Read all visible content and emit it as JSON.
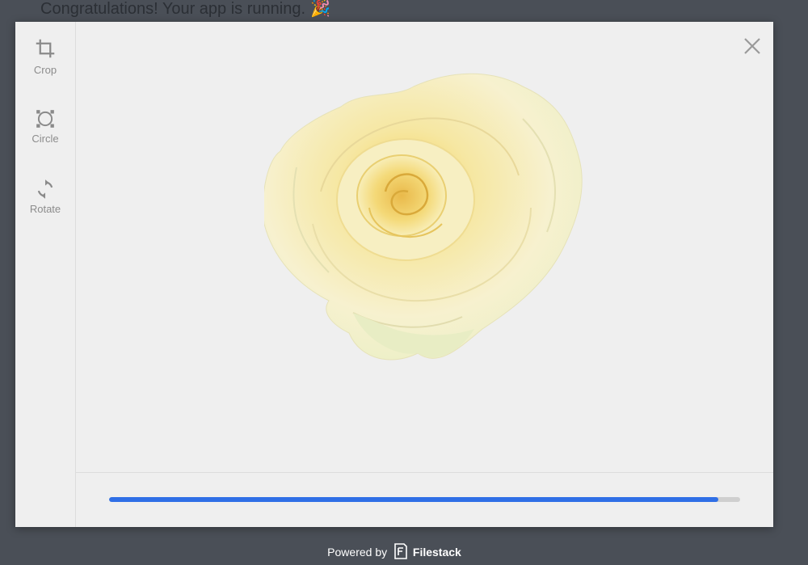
{
  "background": {
    "message": "Congratulations! Your app is running.",
    "emoji": "🎉"
  },
  "sidebar": {
    "tools": [
      {
        "label": "Crop",
        "icon": "crop-icon"
      },
      {
        "label": "Circle",
        "icon": "circle-icon"
      },
      {
        "label": "Rotate",
        "icon": "rotate-icon"
      }
    ]
  },
  "close": {
    "icon": "close-icon"
  },
  "image": {
    "subject": "rose-image"
  },
  "progress": {
    "fraction": 0.965
  },
  "footer": {
    "powered_by": "Powered by",
    "brand": "Filestack",
    "brand_icon": "filestack-logo-icon"
  },
  "colors": {
    "accent": "#2f6fe6",
    "track": "#cfcfcf",
    "panel": "#efefef",
    "backdrop": "#4a4f57"
  }
}
